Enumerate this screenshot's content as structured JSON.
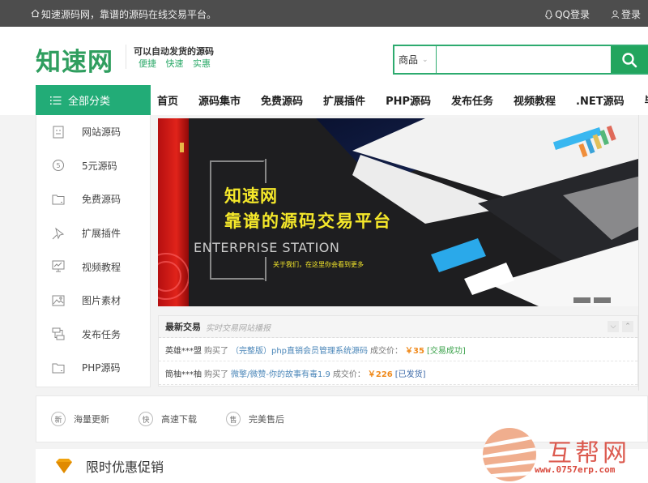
{
  "topbar": {
    "slogan": "知速源码网，靠谱的源码在线交易平台。",
    "qq_login": "QQ登录",
    "login": "登录"
  },
  "header": {
    "logo": "知速网",
    "tagline_main": "可以自动发货的源码",
    "tagline_sub": "便捷 快速 实惠"
  },
  "search": {
    "category": "商品",
    "value": "",
    "placeholder": ""
  },
  "nav": {
    "all_categories": "全部分类",
    "items": [
      "首页",
      "源码集市",
      "免费源码",
      "扩展插件",
      "PHP源码",
      "发布任务",
      "视频教程",
      ".NET源码",
      "毕业"
    ]
  },
  "sidebar": {
    "items": [
      {
        "label": "网站源码",
        "icon": "website-icon"
      },
      {
        "label": "5元源码",
        "icon": "five-coin-icon"
      },
      {
        "label": "免费源码",
        "icon": "folder-icon"
      },
      {
        "label": "扩展插件",
        "icon": "pin-icon"
      },
      {
        "label": "视频教程",
        "icon": "video-icon"
      },
      {
        "label": "图片素材",
        "icon": "image-icon"
      },
      {
        "label": "发布任务",
        "icon": "task-icon"
      },
      {
        "label": "PHP源码",
        "icon": "folder-icon"
      }
    ]
  },
  "banner": {
    "title_line1": "知速网",
    "title_line2": "靠谱的源码交易平台",
    "english": "ENTERPRISE STATION",
    "subtitle": "关于我们，在这里你会看到更多",
    "slides": 2
  },
  "trades": {
    "title": "最新交易",
    "subtitle": "实时交易网站播报",
    "rows": [
      {
        "user": "英雄***盟",
        "action": "购买了",
        "product": "（完整版）php直销会员管理系统源码",
        "price_label": "成交价：",
        "price": "￥35",
        "status": "[交易成功]",
        "status_type": "ok"
      },
      {
        "user": "筒柚***柚",
        "action": "购买了",
        "product": "微擎/微赞-你的故事有毒1.9",
        "price_label": "成交价：",
        "price": "￥226",
        "status": "[已发货]",
        "status_type": "shipped"
      }
    ]
  },
  "features": [
    {
      "badge": "新",
      "label": "海量更新"
    },
    {
      "badge": "快",
      "label": "高速下载"
    },
    {
      "badge": "售",
      "label": "完美售后"
    }
  ],
  "promo": {
    "title": "限时优惠促销"
  },
  "watermark": {
    "title": "互帮网",
    "url": "www.0757erp.com"
  },
  "colors": {
    "brand_green": "#22ac77",
    "search_green": "#22a55e",
    "topbar_bg": "#4d4d4d",
    "price_orange": "#f08b1e",
    "banner_yellow": "#f5e82a"
  }
}
